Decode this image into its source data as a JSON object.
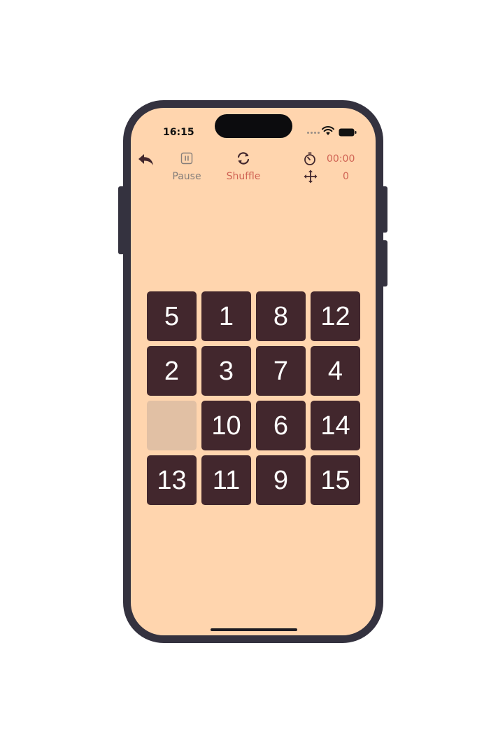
{
  "status_bar": {
    "time": "16:15",
    "icons": [
      "signal-dots-icon",
      "wifi-icon",
      "battery-icon"
    ]
  },
  "toolbar": {
    "back_icon": "back-arrow-icon",
    "pause_label": "Pause",
    "pause_icon": "pause-icon",
    "shuffle_label": "Shuffle",
    "shuffle_icon": "refresh-icon",
    "timer_icon": "stopwatch-icon",
    "timer_value": "00:00",
    "moves_icon": "move-arrows-icon",
    "moves_value": "0"
  },
  "board": {
    "tiles": [
      [
        "5",
        "1",
        "8",
        "12"
      ],
      [
        "2",
        "3",
        "7",
        "4"
      ],
      [
        "",
        "10",
        "6",
        "14"
      ],
      [
        "13",
        "11",
        "9",
        "15"
      ]
    ]
  },
  "colors": {
    "background": "#ffd5ae",
    "tile": "#42272d",
    "empty_tile": "#e1c0a4",
    "accent": "#d06354",
    "muted": "#857e7a"
  }
}
